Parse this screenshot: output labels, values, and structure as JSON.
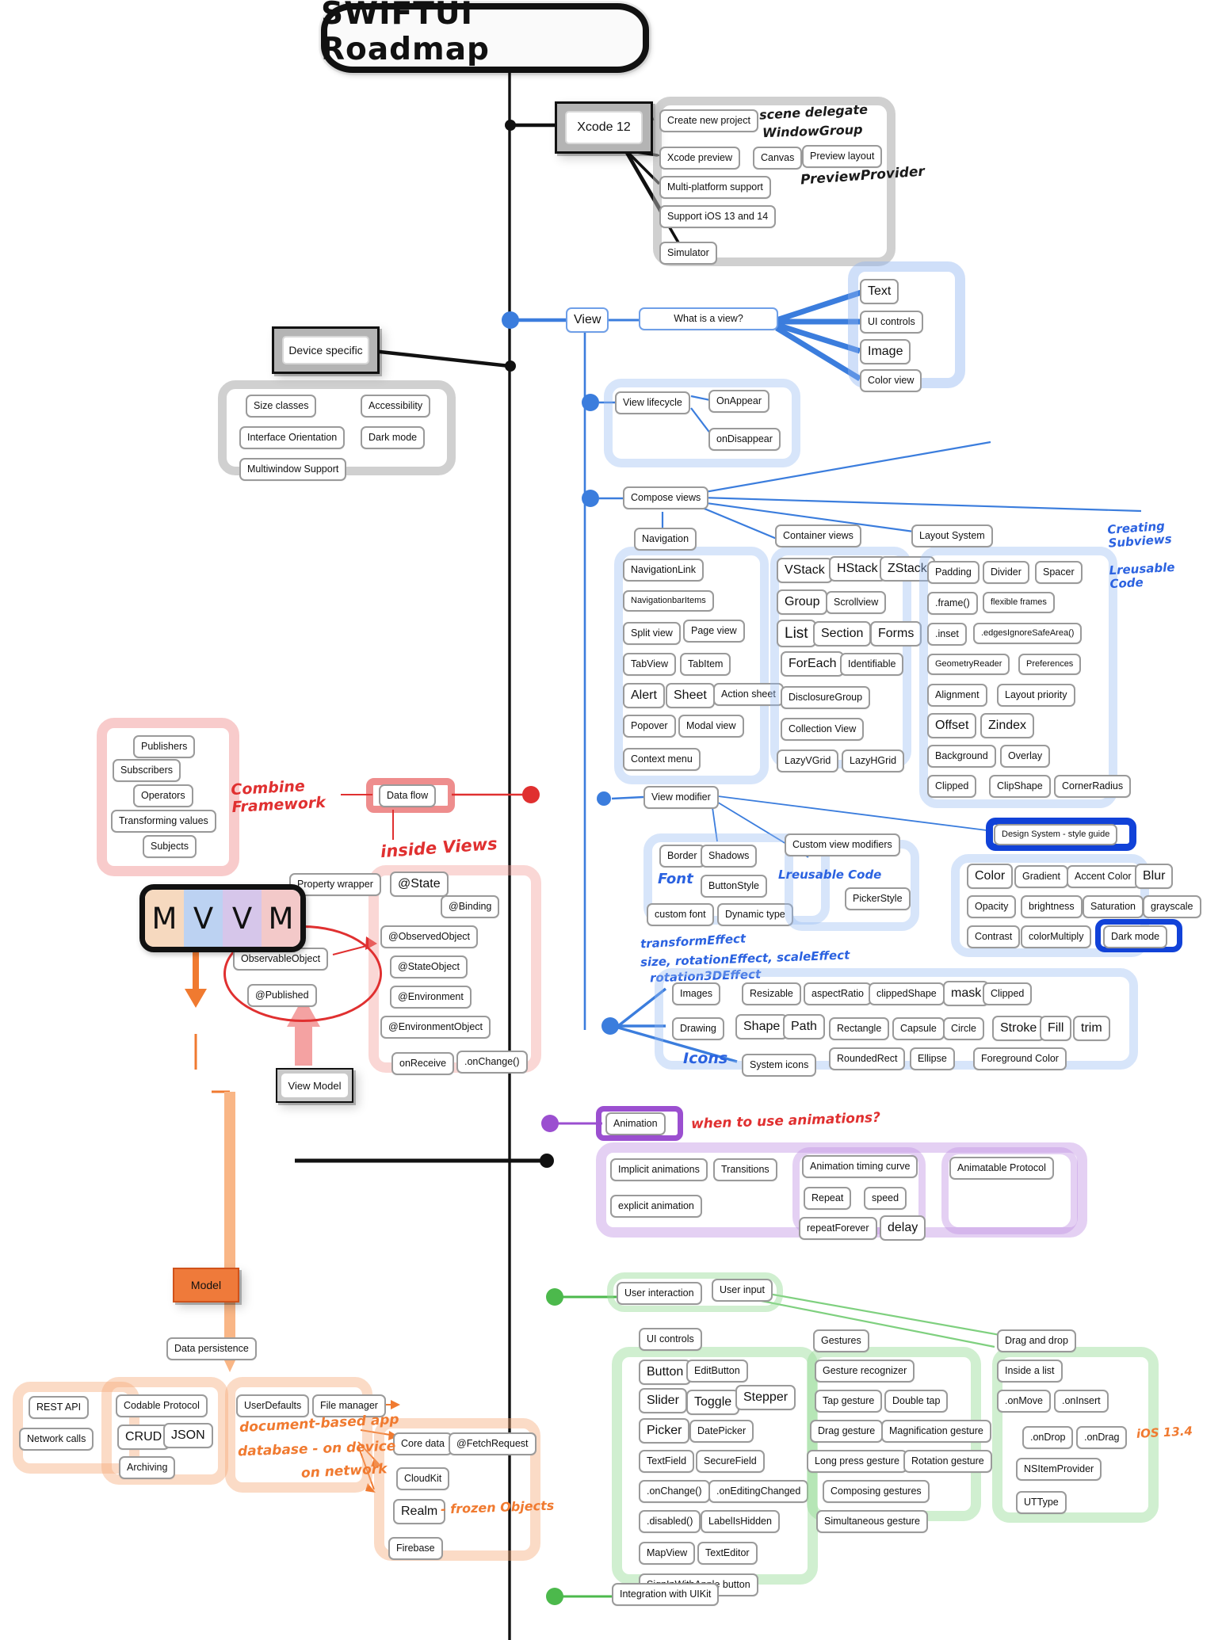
{
  "title": "SWIFTUI Roadmap",
  "branches": {
    "xcode": {
      "label": "Xcode 12",
      "children": [
        "Create new project",
        "Xcode preview",
        "Canvas",
        "Preview layout",
        "Multi-platform support",
        "Support iOS 13 and 14",
        "Simulator"
      ],
      "notes": [
        "scene delegate",
        "WindowGroup",
        "PreviewProvider"
      ]
    },
    "device": {
      "label": "Device specific",
      "children": [
        "Size classes",
        "Accessibility",
        "Interface Orientation",
        "Dark mode",
        "Multiwindow Support"
      ]
    },
    "view": {
      "label": "View",
      "question": "What is a view?",
      "children": [
        "Text",
        "UI controls",
        "Image",
        "Color view"
      ]
    },
    "lifecycle": {
      "label": "View lifecycle",
      "children": [
        "OnAppear",
        "onDisappear"
      ]
    },
    "compose": {
      "label": "Compose views",
      "navigation": {
        "label": "Navigation",
        "children": [
          "NavigationLink",
          "NavigationbarItems",
          "Split view",
          "Page view",
          "TabView",
          "TabItem",
          "Alert",
          "Sheet",
          "Action sheet",
          "Popover",
          "Modal view",
          "Context menu"
        ]
      },
      "container": {
        "label": "Container views",
        "children": [
          "VStack",
          "HStack",
          "ZStack",
          "Group",
          "Scrollview",
          "List",
          "Section",
          "Forms",
          "ForEach",
          "Identifiable",
          "DisclosureGroup",
          "Collection View",
          "LazyVGrid",
          "LazyHGrid"
        ]
      },
      "layout": {
        "label": "Layout System",
        "children": [
          "Padding",
          "Divider",
          "Spacer",
          ".frame()",
          "flexible frames",
          ".inset",
          ".edgesIgnoreSafeArea()",
          "GeometryReader",
          "Preferences",
          "Alignment",
          "Layout priority",
          "Offset",
          "Zindex",
          "Background",
          "Overlay",
          "Clipped",
          "ClipShape",
          "CornerRadius"
        ],
        "note": "Creating\nSubviews"
      },
      "note_reusable": "Lreusable\nCode"
    },
    "modifier": {
      "label": "View modifier",
      "basics": [
        "Border",
        "Shadows",
        "ButtonStyle",
        "custom font",
        "Dynamic type"
      ],
      "custom": {
        "label": "Custom view modifiers",
        "children": [
          "PickerStyle"
        ],
        "note": "Lreusable Code"
      },
      "design_system": {
        "label": "Design System - style guide",
        "children": [
          "Color",
          "Gradient",
          "Accent Color",
          "Blur",
          "Opacity",
          "brightness",
          "Saturation",
          "grayscale",
          "Contrast",
          "colorMultiply",
          "Dark mode"
        ]
      },
      "notes": [
        "Font",
        "transformEffect",
        "size, rotationEffect, scaleEffect",
        "rotation3DEffect"
      ]
    },
    "graphics": {
      "images": {
        "label": "Images",
        "children": [
          "Resizable",
          "aspectRatio",
          "clippedShape",
          "mask",
          "Clipped"
        ]
      },
      "drawing": {
        "label": "Drawing",
        "children": [
          "Shape",
          "Path",
          "Rectangle",
          "Capsule",
          "Circle",
          "Stroke",
          "Fill",
          "trim",
          "RoundedRect",
          "Ellipse",
          "Foreground Color"
        ]
      },
      "icons": {
        "label": "System icons",
        "note": "Icons"
      }
    },
    "dataflow": {
      "label": "Data flow",
      "combine": {
        "note": "Combine\nFramework",
        "children": [
          "Publishers",
          "Subscribers",
          "Operators",
          "Transforming values",
          "Subjects"
        ]
      },
      "inside_views": {
        "note": "inside Views",
        "children": [
          "Property wrapper",
          "@State",
          "@Binding",
          "@ObservedObject",
          "@StateObject",
          "@Environment",
          "@EnvironmentObject",
          "onReceive",
          ".onChange()"
        ]
      },
      "observable": {
        "children": [
          "ObservableObject",
          "@Published"
        ]
      },
      "viewmodel": "View Model"
    },
    "mvvm": {
      "letters": [
        "M",
        "V",
        "V",
        "M"
      ]
    },
    "model": {
      "label": "Model",
      "persistence": "Data persistence",
      "groups": [
        {
          "children": [
            "REST API",
            "Network calls"
          ]
        },
        {
          "children": [
            "Codable Protocol",
            "CRUD",
            "JSON",
            "Archiving"
          ]
        },
        {
          "children": [
            "UserDefaults",
            "File manager"
          ]
        },
        {
          "children": [
            "Core data",
            "@FetchRequest",
            "CloudKit",
            "Realm",
            "Firebase"
          ]
        }
      ],
      "notes": [
        "document-based app",
        "database - on device",
        "on network",
        "- frozen Objects"
      ]
    },
    "animation": {
      "label": "Animation",
      "note": "when to use animations?",
      "children": [
        "Implicit animations",
        "Transitions",
        "explicit animation",
        "Animation timing curve",
        "Repeat",
        "speed",
        "repeatForever",
        "delay",
        "Animatable Protocol"
      ]
    },
    "interaction": {
      "label": "User interaction",
      "input": "User input",
      "ui_controls": {
        "label": "UI controls",
        "children": [
          "Button",
          "EditButton",
          "Slider",
          "Toggle",
          "Stepper",
          "Picker",
          "DatePicker",
          "TextField",
          "SecureField",
          ".onChange()",
          ".onEditingChanged",
          ".disabled()",
          "LabelIsHidden",
          "MapView",
          "TextEditor",
          "SignInWithApple button"
        ]
      },
      "gestures": {
        "label": "Gestures",
        "children": [
          "Gesture recognizer",
          "Tap gesture",
          "Double tap",
          "Drag gesture",
          "Magnification gesture",
          "Long press gesture",
          "Rotation gesture",
          "Composing gestures",
          "Simultaneous gesture"
        ]
      },
      "dragdrop": {
        "label": "Drag and drop",
        "children": [
          "Inside a list",
          ".onMove",
          ".onInsert",
          ".onDrop",
          ".onDrag",
          "NSItemProvider",
          "UTType"
        ],
        "note": "iOS 13.4"
      },
      "integration": "Integration with UIKit"
    }
  },
  "colors": {
    "blue": "#3b7ddd",
    "red": "#e03030",
    "orange": "#f07a30",
    "purple": "#9b4fd0",
    "green": "#4cb94c",
    "dark_blue": "#1142d8"
  }
}
